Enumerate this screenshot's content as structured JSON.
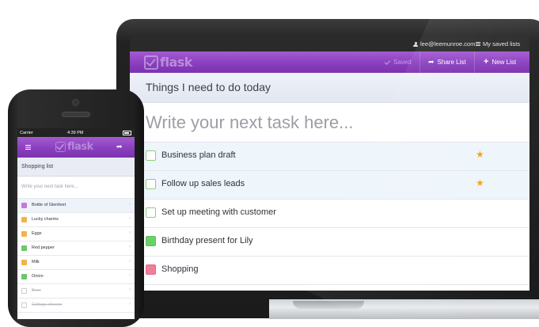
{
  "laptop": {
    "topbar": {
      "user_email": "lee@leemunroe.com",
      "saved_lists": "My saved lists"
    },
    "nav": {
      "logo": "flask",
      "saved": "Saved",
      "share": "Share List",
      "new_list": "New List"
    },
    "list_title": "Things I need to do today",
    "input_placeholder": "Write your next task here...",
    "tasks": [
      {
        "label": "Business plan draft",
        "starred": true,
        "color": "#ffffff"
      },
      {
        "label": "Follow up sales leads",
        "starred": true,
        "color": "#ffffff"
      },
      {
        "label": "Set up meeting with customer",
        "starred": false,
        "color": "#ffffff"
      },
      {
        "label": "Birthday present for Lily",
        "starred": false,
        "color": "#6cd06a"
      },
      {
        "label": "Shopping",
        "starred": false,
        "color": "#f07e9a"
      }
    ],
    "colors": {
      "accent": "#8a3fbf",
      "star": "#f3a21a"
    }
  },
  "phone": {
    "status": {
      "carrier": "Carrier",
      "time": "4:39 PM"
    },
    "nav": {
      "logo": "flask"
    },
    "list_title": "Shopping list",
    "input_placeholder": "Write your next task here...",
    "items": [
      {
        "label": "Bottle of Glenlivet",
        "color": "#c27ad8",
        "done": false
      },
      {
        "label": "Lucky charms",
        "color": "#f4b24a",
        "done": false
      },
      {
        "label": "Eggs",
        "color": "#f4b24a",
        "done": false
      },
      {
        "label": "Red pepper",
        "color": "#6cc866",
        "done": false
      },
      {
        "label": "Milk",
        "color": "#f4b24a",
        "done": false
      },
      {
        "label": "Onion",
        "color": "#6cc866",
        "done": false
      },
      {
        "label": "Beer",
        "color": "#ffffff",
        "done": true
      },
      {
        "label": "Cottage cheese",
        "color": "#ffffff",
        "done": true
      }
    ]
  }
}
